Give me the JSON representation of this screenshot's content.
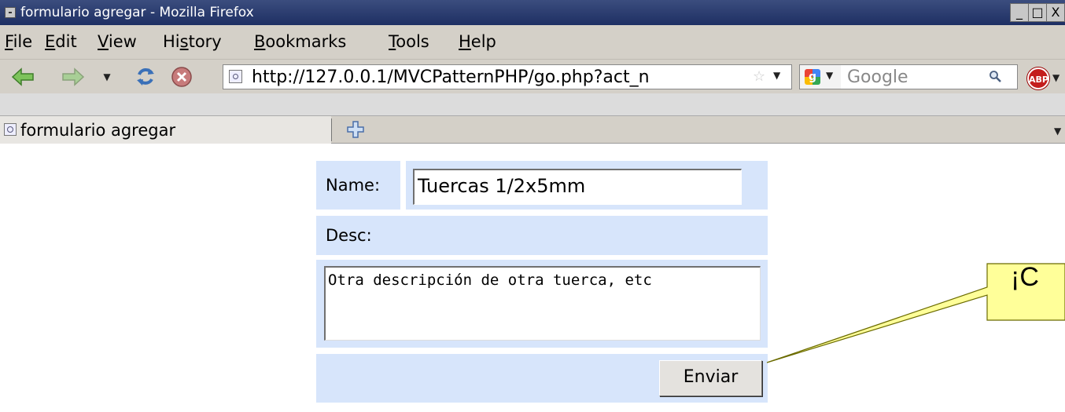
{
  "window": {
    "title": "formulario agregar - Mozilla Firefox",
    "controls": [
      "_",
      "□",
      "X"
    ]
  },
  "menubar": {
    "items": [
      {
        "label": "File",
        "accel": "F"
      },
      {
        "label": "Edit",
        "accel": "E"
      },
      {
        "label": "View",
        "accel": "V"
      },
      {
        "label": "History",
        "accel": "s"
      },
      {
        "label": "Bookmarks",
        "accel": "B"
      },
      {
        "label": "Tools",
        "accel": "T"
      },
      {
        "label": "Help",
        "accel": "H"
      }
    ]
  },
  "navbar": {
    "url": "http://127.0.0.1/MVCPatternPHP/go.php?act_n",
    "search_placeholder": "Google",
    "icons": [
      "back-arrow-icon",
      "forward-arrow-icon",
      "history-dropdown-icon",
      "reload-icon",
      "stop-icon",
      "site-favicon-icon",
      "bookmark-star-icon",
      "google-logo-icon",
      "search-magnifier-icon",
      "adblock-plus-icon"
    ],
    "adblock_label": "ABP"
  },
  "tabs": [
    {
      "label": "formulario agregar"
    }
  ],
  "form": {
    "name_label": "Name:",
    "name_value": "Tuercas 1/2x5mm",
    "desc_label": "Desc:",
    "desc_value": "Otra descripción de otra tuerca, etc",
    "submit_label": "Enviar"
  },
  "callout": {
    "text": "¡C"
  },
  "colors": {
    "title_bar": "#2a3b6e",
    "chrome": "#d4d0c8",
    "form_cell": "#d7e5fb",
    "callout_fill": "#ffff99",
    "adblock_red": "#c41d1d"
  }
}
